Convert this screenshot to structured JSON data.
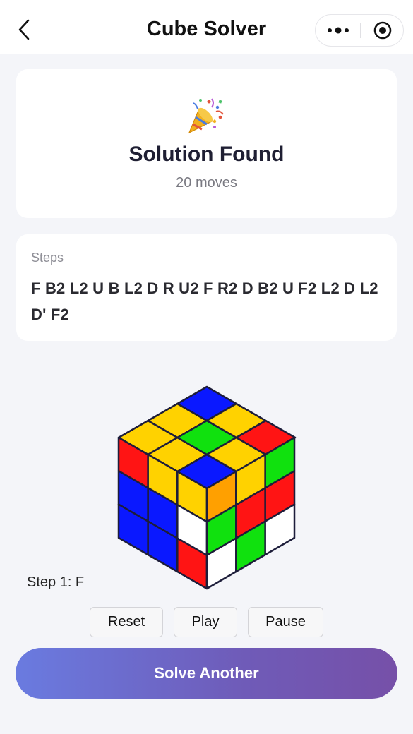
{
  "nav": {
    "title": "Cube Solver",
    "back_icon": "chevron-left-icon",
    "more_icon": "more-dots-icon",
    "close_icon": "record-icon"
  },
  "result": {
    "icon": "party-popper-icon",
    "title": "Solution Found",
    "subtitle": "20 moves"
  },
  "steps": {
    "label": "Steps",
    "sequence": "F B2 L2 U B L2 D R U2 F R2 D B2 U F2 L2 D L2 D' F2"
  },
  "player": {
    "current_step": "Step 1: F",
    "buttons": {
      "reset": "Reset",
      "play": "Play",
      "pause": "Pause"
    }
  },
  "cube": {
    "top": [
      [
        "yellow",
        "yellow",
        "blue"
      ],
      [
        "yellow",
        "green",
        "yellow"
      ],
      [
        "blue",
        "yellow",
        "red"
      ]
    ],
    "left": [
      [
        "red",
        "yellow",
        "yellow"
      ],
      [
        "blue",
        "blue",
        "white"
      ],
      [
        "blue",
        "blue",
        "red"
      ]
    ],
    "right": [
      [
        "orange",
        "yellow",
        "green"
      ],
      [
        "green",
        "red",
        "red"
      ],
      [
        "white",
        "green",
        "white"
      ]
    ],
    "colors": {
      "yellow": "#ffd200",
      "blue": "#0a18ff",
      "red": "#ff1414",
      "green": "#10e10e",
      "orange": "#ffa000",
      "white": "#ffffff"
    }
  },
  "cta": {
    "label": "Solve Another",
    "gradient_start": "#6a7be0",
    "gradient_end": "#7650a8"
  }
}
